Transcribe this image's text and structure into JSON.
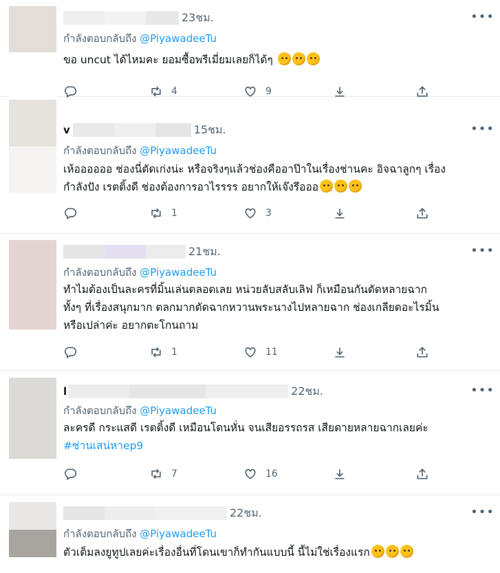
{
  "reply_prefix": "กำลังตอบกลับถึง",
  "mention": "@PiyawadeeTu",
  "icons": {
    "reply": "reply-icon",
    "retweet": "retweet-icon",
    "like": "like-icon",
    "share": "share-icon",
    "export": "export-icon",
    "more": "more-icon"
  },
  "tweets": [
    {
      "time": "23ชม.",
      "text_lines": [
        "ขอ uncut ได้ไหมคะ ยอมซื้อพรีเมี่ยมเลยก็ได้ๆ"
      ],
      "retweets": "4",
      "likes": "9"
    },
    {
      "time": "15ชม.",
      "text_lines": [
        "เห้ออออออ ช่องนี่ตัดเก่งน่ะ หรือจริงๆแล้วช่องคืออาป๊าในเรื่องช่านคะ อิจฉาลูกๆ เรื่อง",
        "กำลังปัง เรตติ้งดี ช่องต้องการอาไรรรร อยากให้เจ๊งรึอออ"
      ],
      "retweets": "1",
      "likes": "3"
    },
    {
      "time": "21ชม.",
      "text_lines": [
        "ทำไมต้องเป็นละครที่มิ้นเล่นตลอดเลย หน่วยลับสลับเลิฟ ก็เหมือนกันตัดหลายฉาก",
        "ทั้งๆ ที่เรื่องสนุกมาก ตลกมากตัดฉากหวานพระนางไปหลายฉาก ช่องเกลียดอะไรมิ้น",
        "หรือเปล่าค่ะ อยากตะโกนถาม"
      ],
      "retweets": "1",
      "likes": "11"
    },
    {
      "time": "22ชม.",
      "text_lines": [
        "ละครดี กระแสดี เรตติ้งดี เหมือนโดนหั่น จนเสียอรรถรส เสียดายหลายฉากเลยค่ะ"
      ],
      "hashtag": "#ซ่านเสน่หาep9",
      "retweets": "7",
      "likes": "16"
    },
    {
      "time": "22ชม.",
      "text_lines": [
        "ตัวเต็มลงยูทูปเลยค่ะเรื่องอื่นที่โดนเขาก็ทำกันแบบนี้ นี้ไม่ใช่เรื่องแรก"
      ]
    }
  ]
}
